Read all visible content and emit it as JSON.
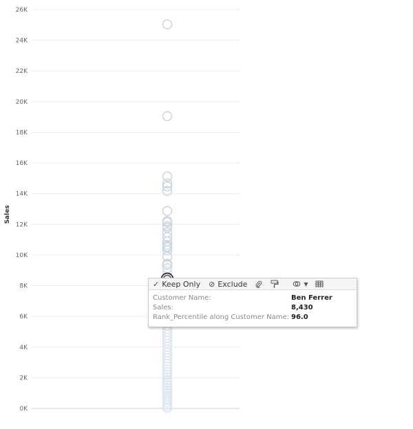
{
  "chart_data": {
    "type": "scatter",
    "title": "",
    "xlabel": "",
    "ylabel": "Sales",
    "ylim": [
      0,
      26000
    ],
    "yticks": [
      0,
      2000,
      4000,
      6000,
      8000,
      10000,
      12000,
      14000,
      16000,
      18000,
      20000,
      22000,
      24000,
      26000
    ],
    "ytick_labels": [
      "0K",
      "2K",
      "4K",
      "6K",
      "8K",
      "10K",
      "12K",
      "14K",
      "16K",
      "18K",
      "20K",
      "22K",
      "24K",
      "26K"
    ],
    "grid": true,
    "y": [
      25043,
      19052,
      15117,
      14662,
      14473,
      14175,
      12873,
      12210,
      12129,
      11891,
      11790,
      11470,
      11165,
      10880,
      10663,
      10540,
      10501,
      10310,
      9892,
      9431,
      9351,
      9133,
      8981,
      8870,
      8430,
      8180,
      7950,
      7720,
      7500,
      7280,
      7060,
      6850,
      6640,
      6420,
      6210,
      6000,
      5800,
      5590,
      5390,
      5190,
      4990,
      4790,
      4600,
      4400,
      4210,
      4020,
      3830,
      3640,
      3450,
      3270,
      3080,
      2900,
      2720,
      2540,
      2360,
      2180,
      2010,
      1840,
      1670,
      1500,
      1330,
      1170,
      1010,
      850,
      700,
      550,
      400,
      260,
      130,
      20
    ],
    "selected": {
      "y": 8430
    }
  },
  "tooltip": {
    "keep_only": "Keep Only",
    "exclude": "Exclude",
    "fields": [
      {
        "label": "Customer Name:",
        "value": "Ben Ferrer"
      },
      {
        "label": "Sales:",
        "value": "8,430"
      },
      {
        "label": "Rank_Percentile along Customer Name:",
        "value": "96.0"
      }
    ]
  },
  "icons": {
    "keep_only": "✓",
    "exclude": "⊘",
    "group": "paperclip-icon",
    "format": "paint-roller-icon",
    "sets": "sets-icon",
    "view_data": "view-data-icon"
  }
}
